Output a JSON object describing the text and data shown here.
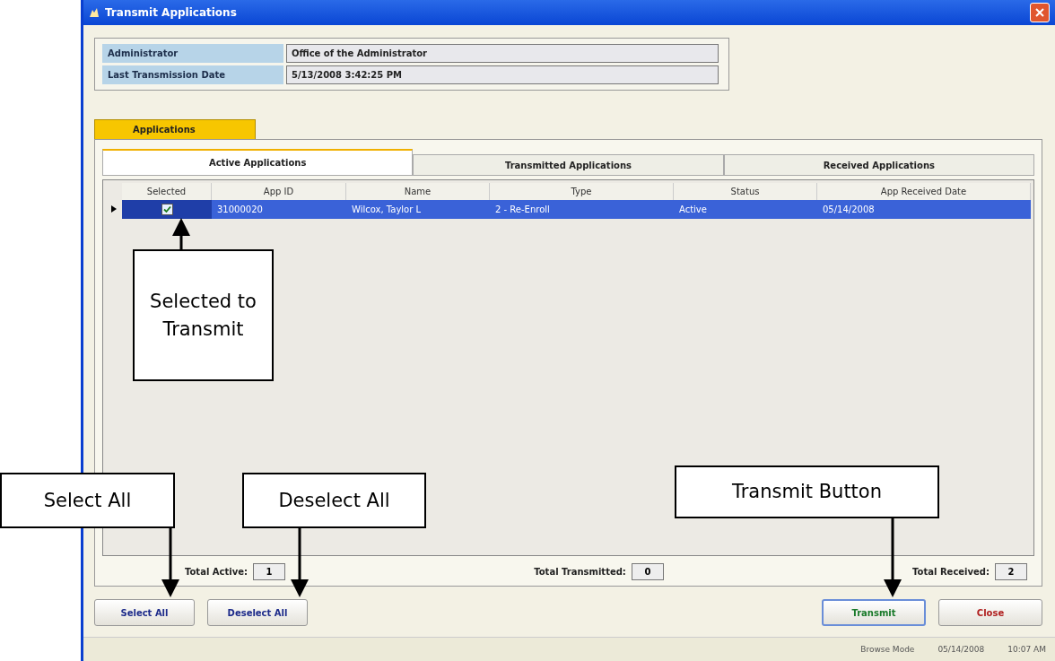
{
  "window": {
    "title": "Transmit Applications"
  },
  "info_fields": [
    {
      "label": "Administrator",
      "value": "Office of the Administrator"
    },
    {
      "label": "Last Transmission Date",
      "value": "5/13/2008 3:42:25 PM"
    }
  ],
  "outer_tabs": [
    {
      "label": "Applications",
      "selected": true
    }
  ],
  "inner_tabs": [
    {
      "label": "Active Applications",
      "selected": true
    },
    {
      "label": "Transmitted Applications",
      "selected": false
    },
    {
      "label": "Received Applications",
      "selected": false
    }
  ],
  "table": {
    "columns": [
      "Selected",
      "App ID",
      "Name",
      "Type",
      "Status",
      "App Received Date"
    ],
    "rows": [
      {
        "selected": true,
        "checked": true,
        "cells": [
          "",
          "31000020",
          "Wilcox, Taylor L",
          "2 - Re-Enroll",
          "Active",
          "05/14/2008"
        ]
      }
    ]
  },
  "totals": [
    {
      "label": "Total Active:",
      "value": "1"
    },
    {
      "label": "Total Transmitted:",
      "value": "0"
    },
    {
      "label": "Total Received:",
      "value": "2"
    }
  ],
  "buttons": [
    {
      "label": "Select All",
      "kind": "normal"
    },
    {
      "label": "Deselect All",
      "kind": "normal"
    },
    {
      "label": "Transmit",
      "kind": "primary"
    },
    {
      "label": "Close",
      "kind": "danger"
    }
  ],
  "status_bar": [
    "Browse Mode",
    "05/14/2008",
    "10:07 AM"
  ],
  "callouts": [
    {
      "text": "Selected to Transmit"
    },
    {
      "text": "Select All"
    },
    {
      "text": "Deselect All"
    },
    {
      "text": "Transmit Button"
    }
  ]
}
